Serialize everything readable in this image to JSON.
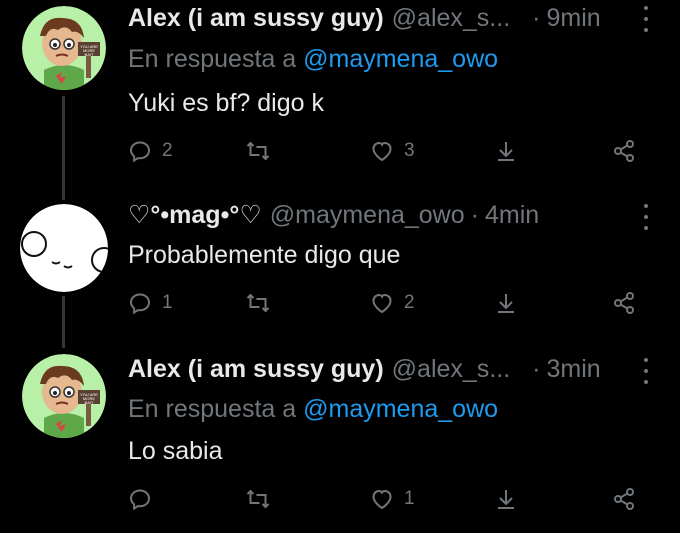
{
  "tweets": [
    {
      "display_name": "Alex (i am sussy guy)",
      "handle": "@alex_s...",
      "separator": "·",
      "time": "9min",
      "replying_prefix": "En respuesta a",
      "replying_to": "@maymena_owo",
      "text": "Yuki es bf? digo k",
      "replies": "2",
      "retweets": "",
      "likes": "3",
      "avatar_badge_text": "YOU ARE MORE BAIT"
    },
    {
      "display_name": "♡°•mag•°♡",
      "handle": "@maymena_owo",
      "separator": "·",
      "time": "4min",
      "text": "Probablemente digo que",
      "replies": "1",
      "retweets": "",
      "likes": "2"
    },
    {
      "display_name": "Alex (i am sussy guy)",
      "handle": "@alex_s...",
      "separator": "·",
      "time": "3min",
      "replying_prefix": "En respuesta a",
      "replying_to": "@maymena_owo",
      "text": "Lo sabia",
      "replies": "",
      "retweets": "",
      "likes": "1",
      "avatar_badge_text": "YOU ARE MORE BAIT"
    }
  ],
  "colors": {
    "background": "#000000",
    "text": "#e7e9ea",
    "secondary": "#71767b",
    "link": "#1d9bf0",
    "thread_line": "#333639",
    "avatar_bg": "#b8f0a8"
  },
  "icons": [
    "reply-icon",
    "retweet-icon",
    "like-icon",
    "download-icon",
    "share-icon",
    "more-icon"
  ]
}
